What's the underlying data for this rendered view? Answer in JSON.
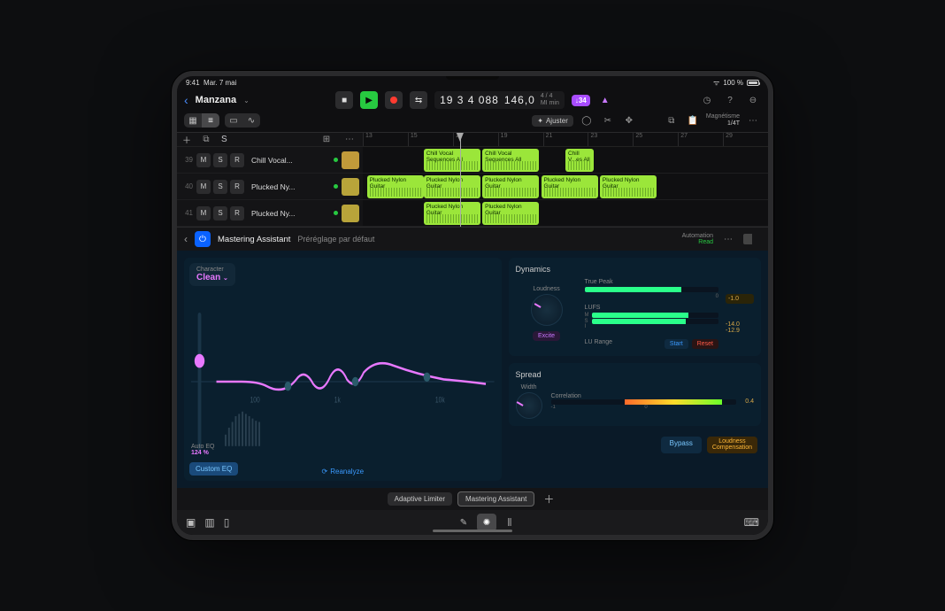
{
  "status": {
    "time": "9:41",
    "date": "Mar. 7 mai",
    "battery_pct": "100 %"
  },
  "project": {
    "name": "Manzana"
  },
  "transport": {
    "position": "19 3 4 088",
    "tempo": "146,0",
    "sig_top": "4 / 4",
    "sig_bot": "MI min",
    "bars_tag": "↓34"
  },
  "toolbar": {
    "adjust_label": "Ajuster",
    "metronome_label": "Magnétisme",
    "metronome_value": "1/4T"
  },
  "ruler_ticks": [
    "13",
    "15",
    "17",
    "19",
    "21",
    "23",
    "25",
    "27",
    "29"
  ],
  "tracks": [
    {
      "num": "39",
      "name": "Chill Vocal...",
      "icon": "drum"
    },
    {
      "num": "40",
      "name": "Plucked Ny...",
      "icon": "inst"
    },
    {
      "num": "41",
      "name": "Plucked Ny...",
      "icon": "inst"
    }
  ],
  "regions": {
    "r1": [
      {
        "l": 15,
        "w": 14,
        "name": "Chill Vocal Sequences All"
      },
      {
        "l": 29.5,
        "w": 14,
        "name": "Chill Vocal Sequences All"
      },
      {
        "l": 50,
        "w": 7,
        "name": "Chill V...es All"
      }
    ],
    "r2": [
      {
        "l": 1,
        "w": 14,
        "name": "Plucked Nylon Guitar"
      },
      {
        "l": 15,
        "w": 14,
        "name": "Plucked Nylon Guitar"
      },
      {
        "l": 29.5,
        "w": 14,
        "name": "Plucked Nylon Guitar"
      },
      {
        "l": 44,
        "w": 14,
        "name": "Plucked Nylon Guitar"
      },
      {
        "l": 58.5,
        "w": 14,
        "name": "Plucked Nylon Guitar"
      }
    ],
    "r3": [
      {
        "l": 15,
        "w": 14,
        "name": "Plucked Nylon Guitar"
      },
      {
        "l": 29.5,
        "w": 14,
        "name": "Plucked Nylon Guitar"
      }
    ]
  },
  "plugin": {
    "name": "Mastering Assistant",
    "preset": "Préréglage par défaut",
    "automation_label": "Automation",
    "automation_value": "Read"
  },
  "master": {
    "character_label": "Character",
    "character_value": "Clean",
    "auto_eq_label": "Auto EQ",
    "auto_eq_value": "124 %",
    "custom_eq": "Custom EQ",
    "reanalyze": "Reanalyze",
    "dynamics_title": "Dynamics",
    "loudness_label": "Loudness",
    "excite_label": "Excite",
    "true_peak_label": "True Peak",
    "true_peak_scale": "0",
    "true_peak_value": "-1.0",
    "lufs_label": "LUFS",
    "lufs_m": "M",
    "lufs_s": "S",
    "lufs_i": "I",
    "lufs_val_top": "-14.0",
    "lufs_val_bot": "-12.9",
    "lu_range_label": "LU Range",
    "start_btn": "Start",
    "reset_btn": "Reset",
    "spread_title": "Spread",
    "width_label": "Width",
    "correlation_label": "Correlation",
    "correlation_scale_neg": "-1",
    "correlation_scale_zero": "0",
    "correlation_value": "0.4",
    "bypass": "Bypass",
    "loud_comp_l1": "Loudness",
    "loud_comp_l2": "Compensation"
  },
  "chain": {
    "adaptive": "Adaptive Limiter",
    "mastering": "Mastering Assistant"
  },
  "track_buttons": {
    "m": "M",
    "s": "S",
    "r": "R"
  },
  "header_s": "S"
}
